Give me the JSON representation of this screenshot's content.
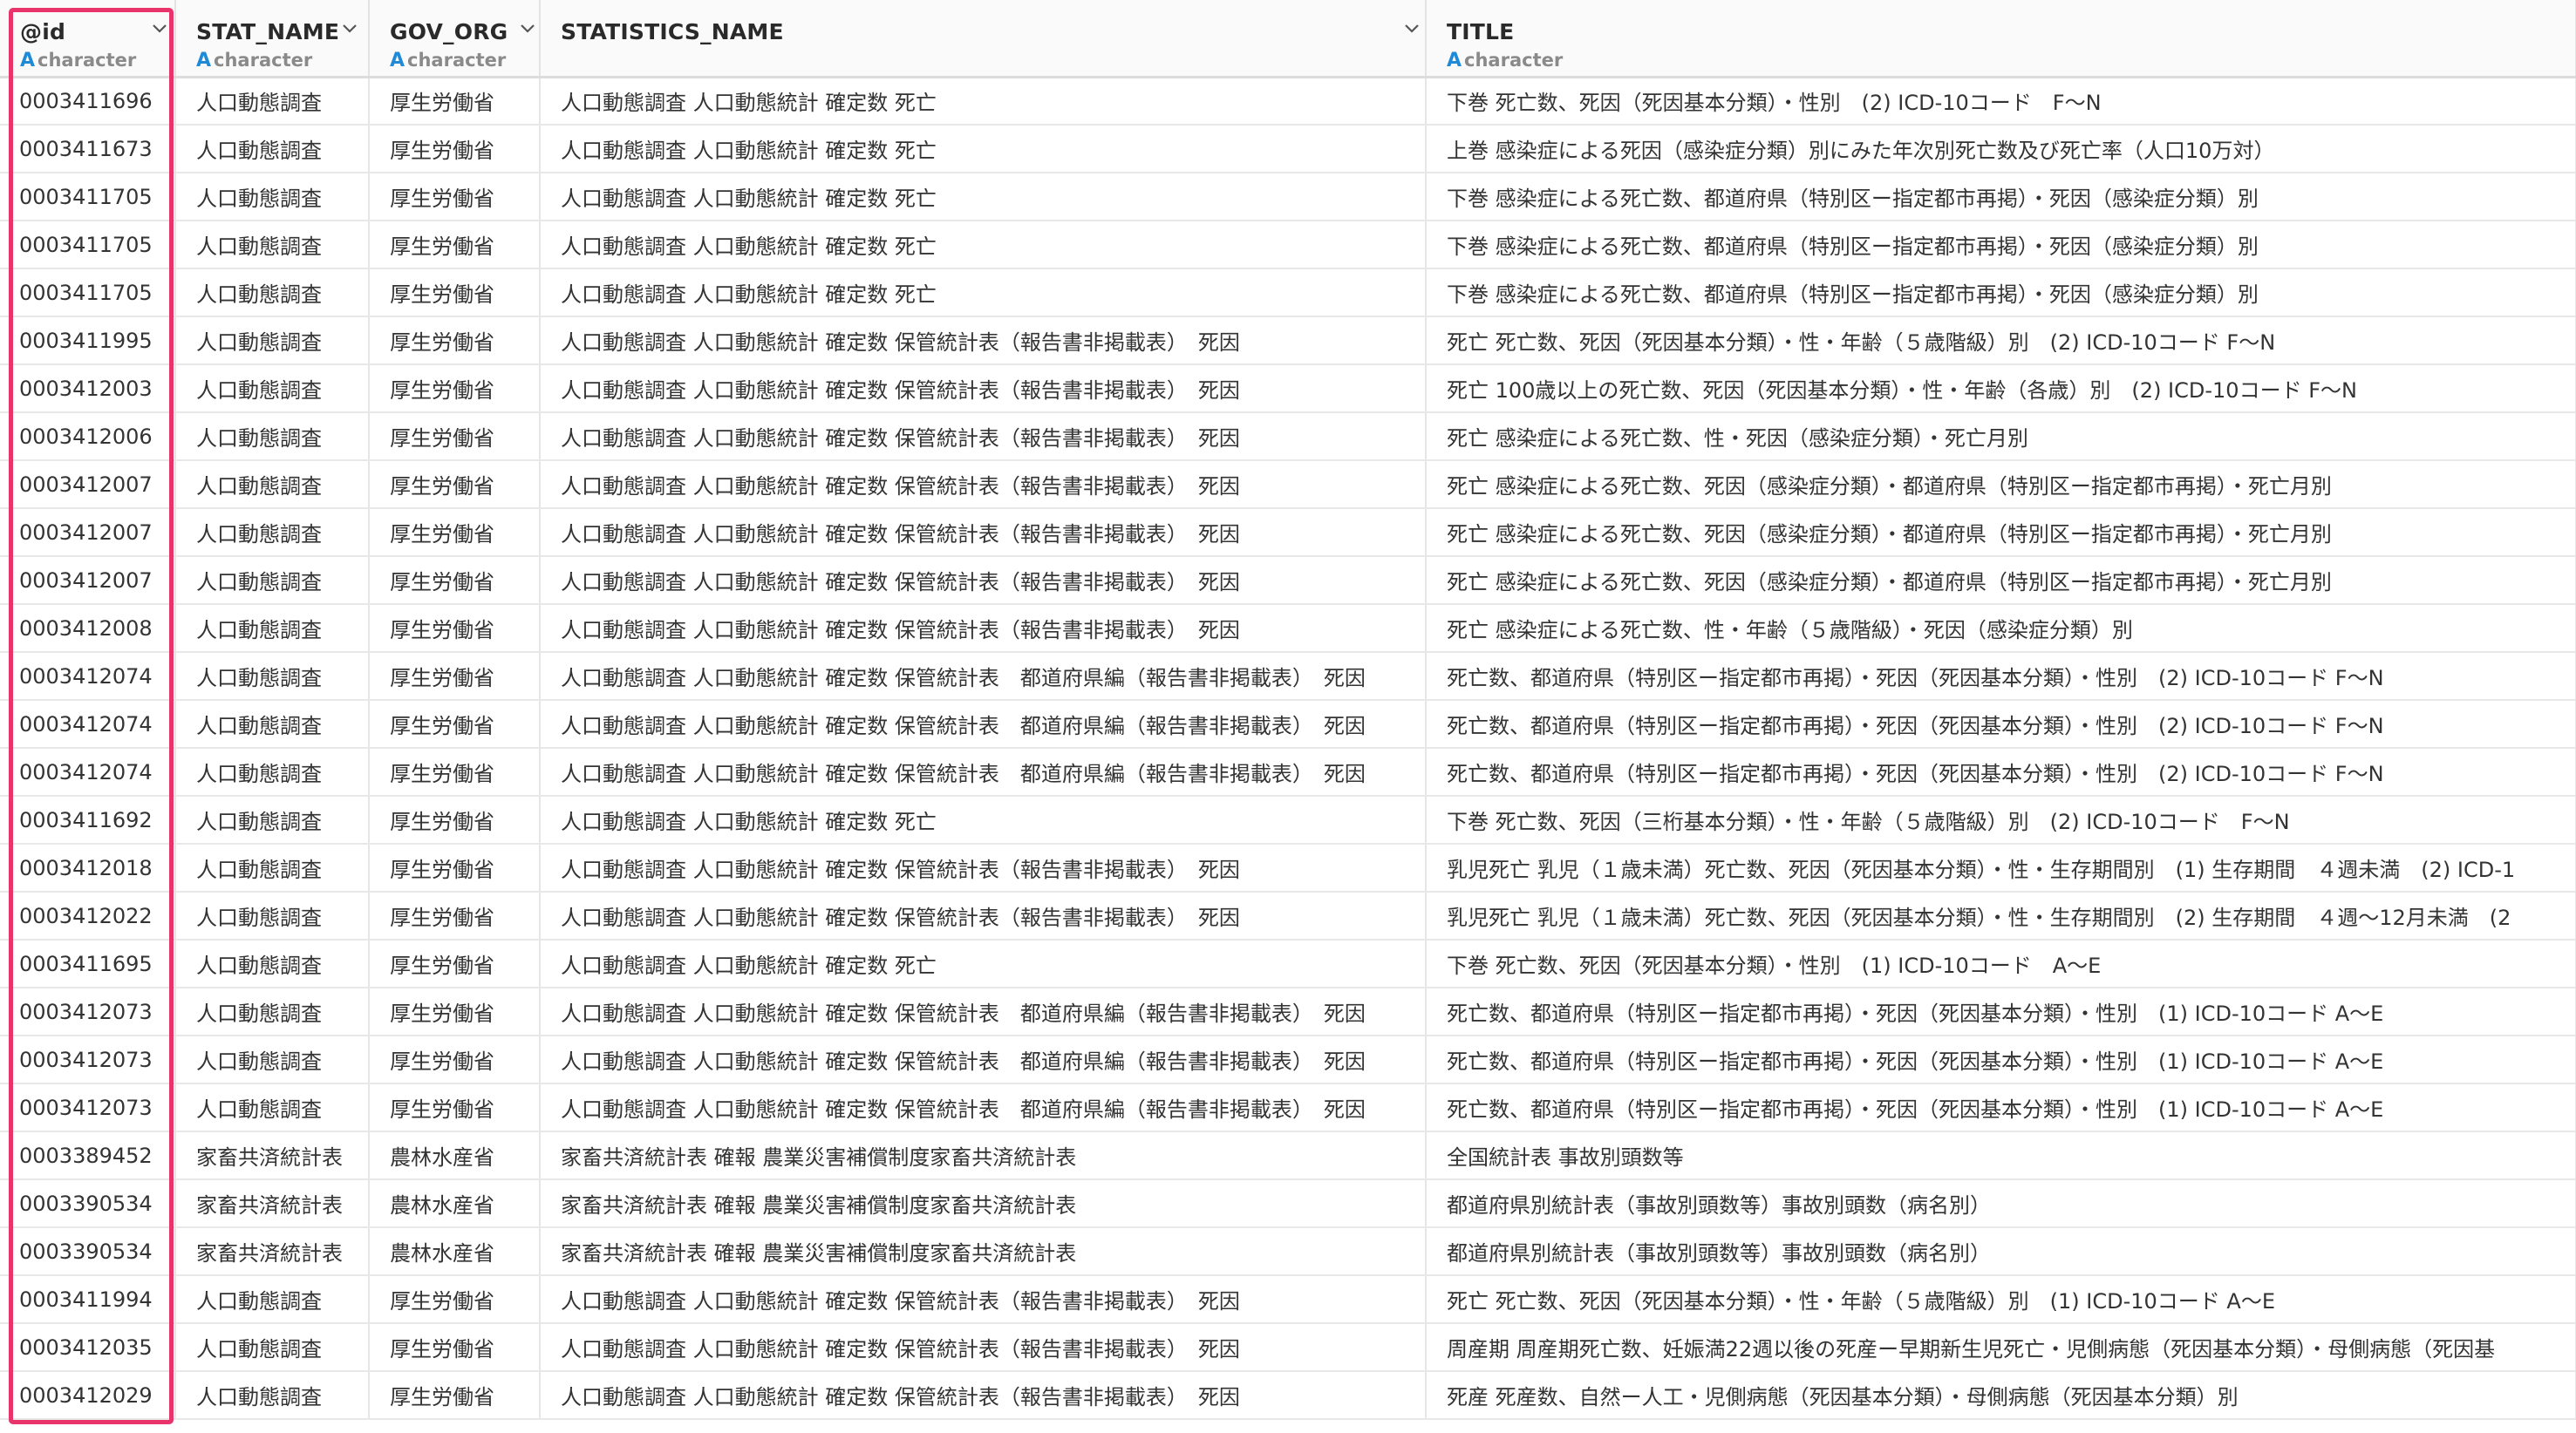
{
  "columns": [
    {
      "name": "@id",
      "type_letter": "A",
      "type": "character",
      "has_menu": true
    },
    {
      "name": "STAT_NAME",
      "type_letter": "A",
      "type": "character",
      "has_menu": true
    },
    {
      "name": "GOV_ORG",
      "type_letter": "A",
      "type": "character",
      "has_menu": true
    },
    {
      "name": "STATISTICS_NAME",
      "type_letter": "",
      "type": "",
      "has_menu": true
    },
    {
      "name": "TITLE",
      "type_letter": "A",
      "type": "character",
      "has_menu": false
    }
  ],
  "stat_name_header_type_letter": "A",
  "stat_name_header_type": "character",
  "rows": [
    [
      "0003411696",
      "人口動態調査",
      "厚生労働省",
      "人口動態調査 人口動態統計 確定数 死亡",
      "下巻 死亡数、死因（死因基本分類）・性別　(2) ICD-10コード　F〜N"
    ],
    [
      "0003411673",
      "人口動態調査",
      "厚生労働省",
      "人口動態調査 人口動態統計 確定数 死亡",
      "上巻 感染症による死因（感染症分類）別にみた年次別死亡数及び死亡率（人口10万対）"
    ],
    [
      "0003411705",
      "人口動態調査",
      "厚生労働省",
      "人口動態調査 人口動態統計 確定数 死亡",
      "下巻 感染症による死亡数、都道府県（特別区ー指定都市再掲）・死因（感染症分類）別"
    ],
    [
      "0003411705",
      "人口動態調査",
      "厚生労働省",
      "人口動態調査 人口動態統計 確定数 死亡",
      "下巻 感染症による死亡数、都道府県（特別区ー指定都市再掲）・死因（感染症分類）別"
    ],
    [
      "0003411705",
      "人口動態調査",
      "厚生労働省",
      "人口動態調査 人口動態統計 確定数 死亡",
      "下巻 感染症による死亡数、都道府県（特別区ー指定都市再掲）・死因（感染症分類）別"
    ],
    [
      "0003411995",
      "人口動態調査",
      "厚生労働省",
      "人口動態調査 人口動態統計 確定数 保管統計表（報告書非掲載表）　死因",
      "死亡 死亡数、死因（死因基本分類）・性・年齢（５歳階級）別　(2) ICD-10コード F〜N"
    ],
    [
      "0003412003",
      "人口動態調査",
      "厚生労働省",
      "人口動態調査 人口動態統計 確定数 保管統計表（報告書非掲載表）　死因",
      "死亡 100歳以上の死亡数、死因（死因基本分類）・性・年齢（各歳）別　(2) ICD-10コード F〜N"
    ],
    [
      "0003412006",
      "人口動態調査",
      "厚生労働省",
      "人口動態調査 人口動態統計 確定数 保管統計表（報告書非掲載表）　死因",
      "死亡 感染症による死亡数、性・死因（感染症分類）・死亡月別"
    ],
    [
      "0003412007",
      "人口動態調査",
      "厚生労働省",
      "人口動態調査 人口動態統計 確定数 保管統計表（報告書非掲載表）　死因",
      "死亡 感染症による死亡数、死因（感染症分類）・都道府県（特別区ー指定都市再掲）・死亡月別"
    ],
    [
      "0003412007",
      "人口動態調査",
      "厚生労働省",
      "人口動態調査 人口動態統計 確定数 保管統計表（報告書非掲載表）　死因",
      "死亡 感染症による死亡数、死因（感染症分類）・都道府県（特別区ー指定都市再掲）・死亡月別"
    ],
    [
      "0003412007",
      "人口動態調査",
      "厚生労働省",
      "人口動態調査 人口動態統計 確定数 保管統計表（報告書非掲載表）　死因",
      "死亡 感染症による死亡数、死因（感染症分類）・都道府県（特別区ー指定都市再掲）・死亡月別"
    ],
    [
      "0003412008",
      "人口動態調査",
      "厚生労働省",
      "人口動態調査 人口動態統計 確定数 保管統計表（報告書非掲載表）　死因",
      "死亡 感染症による死亡数、性・年齢（５歳階級）・死因（感染症分類）別"
    ],
    [
      "0003412074",
      "人口動態調査",
      "厚生労働省",
      "人口動態調査 人口動態統計 確定数 保管統計表　都道府県編（報告書非掲載表）　死因",
      "死亡数、都道府県（特別区ー指定都市再掲）・死因（死因基本分類）・性別　(2) ICD-10コード F〜N"
    ],
    [
      "0003412074",
      "人口動態調査",
      "厚生労働省",
      "人口動態調査 人口動態統計 確定数 保管統計表　都道府県編（報告書非掲載表）　死因",
      "死亡数、都道府県（特別区ー指定都市再掲）・死因（死因基本分類）・性別　(2) ICD-10コード F〜N"
    ],
    [
      "0003412074",
      "人口動態調査",
      "厚生労働省",
      "人口動態調査 人口動態統計 確定数 保管統計表　都道府県編（報告書非掲載表）　死因",
      "死亡数、都道府県（特別区ー指定都市再掲）・死因（死因基本分類）・性別　(2) ICD-10コード F〜N"
    ],
    [
      "0003411692",
      "人口動態調査",
      "厚生労働省",
      "人口動態調査 人口動態統計 確定数 死亡",
      "下巻 死亡数、死因（三桁基本分類）・性・年齢（５歳階級）別　(2) ICD-10コード　F〜N"
    ],
    [
      "0003412018",
      "人口動態調査",
      "厚生労働省",
      "人口動態調査 人口動態統計 確定数 保管統計表（報告書非掲載表）　死因",
      "乳児死亡 乳児（１歳未満）死亡数、死因（死因基本分類）・性・生存期間別　(1) 生存期間　４週未満　(2) ICD-1"
    ],
    [
      "0003412022",
      "人口動態調査",
      "厚生労働省",
      "人口動態調査 人口動態統計 確定数 保管統計表（報告書非掲載表）　死因",
      "乳児死亡 乳児（１歳未満）死亡数、死因（死因基本分類）・性・生存期間別　(2) 生存期間　４週〜12月未満　(2"
    ],
    [
      "0003411695",
      "人口動態調査",
      "厚生労働省",
      "人口動態調査 人口動態統計 確定数 死亡",
      "下巻 死亡数、死因（死因基本分類）・性別　(1) ICD-10コード　A〜E"
    ],
    [
      "0003412073",
      "人口動態調査",
      "厚生労働省",
      "人口動態調査 人口動態統計 確定数 保管統計表　都道府県編（報告書非掲載表）　死因",
      "死亡数、都道府県（特別区ー指定都市再掲）・死因（死因基本分類）・性別　(1) ICD-10コード A〜E"
    ],
    [
      "0003412073",
      "人口動態調査",
      "厚生労働省",
      "人口動態調査 人口動態統計 確定数 保管統計表　都道府県編（報告書非掲載表）　死因",
      "死亡数、都道府県（特別区ー指定都市再掲）・死因（死因基本分類）・性別　(1) ICD-10コード A〜E"
    ],
    [
      "0003412073",
      "人口動態調査",
      "厚生労働省",
      "人口動態調査 人口動態統計 確定数 保管統計表　都道府県編（報告書非掲載表）　死因",
      "死亡数、都道府県（特別区ー指定都市再掲）・死因（死因基本分類）・性別　(1) ICD-10コード A〜E"
    ],
    [
      "0003389452",
      "家畜共済統計表",
      "農林水産省",
      "家畜共済統計表 確報 農業災害補償制度家畜共済統計表",
      "全国統計表 事故別頭数等"
    ],
    [
      "0003390534",
      "家畜共済統計表",
      "農林水産省",
      "家畜共済統計表 確報 農業災害補償制度家畜共済統計表",
      "都道府県別統計表（事故別頭数等）事故別頭数（病名別）"
    ],
    [
      "0003390534",
      "家畜共済統計表",
      "農林水産省",
      "家畜共済統計表 確報 農業災害補償制度家畜共済統計表",
      "都道府県別統計表（事故別頭数等）事故別頭数（病名別）"
    ],
    [
      "0003411994",
      "人口動態調査",
      "厚生労働省",
      "人口動態調査 人口動態統計 確定数 保管統計表（報告書非掲載表）　死因",
      "死亡 死亡数、死因（死因基本分類）・性・年齢（５歳階級）別　(1) ICD-10コード A〜E"
    ],
    [
      "0003412035",
      "人口動態調査",
      "厚生労働省",
      "人口動態調査 人口動態統計 確定数 保管統計表（報告書非掲載表）　死因",
      "周産期 周産期死亡数、妊娠満22週以後の死産ー早期新生児死亡・児側病態（死因基本分類）・母側病態（死因基"
    ],
    [
      "0003412029",
      "人口動態調査",
      "厚生労働省",
      "人口動態調査 人口動態統計 確定数 保管統計表（報告書非掲載表）　死因",
      "死産 死産数、自然ー人工・児側病態（死因基本分類）・母側病態（死因基本分類）別"
    ]
  ],
  "colors": {
    "highlight": "#e8336b",
    "type_letter": "#1f8ad6",
    "header_bg": "#fafafa"
  }
}
